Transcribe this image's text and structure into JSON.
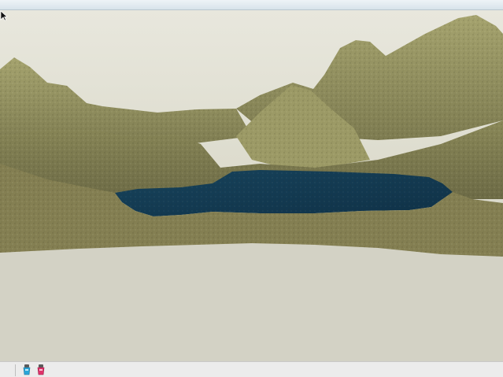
{
  "scene": {
    "description_items": [
      "terrain",
      "lake",
      "ground-plane"
    ],
    "colors": {
      "sky": "#e3e2d8",
      "ground": "#d2d1c5",
      "terrain_light": "#9b9a66",
      "terrain_dark": "#6e6d45",
      "water": "#123a52"
    }
  },
  "status_bar": {
    "icons": [
      "geo-location-icon",
      "credits-icon"
    ]
  },
  "cursor": {
    "icon": "mouse-pointer-icon"
  }
}
